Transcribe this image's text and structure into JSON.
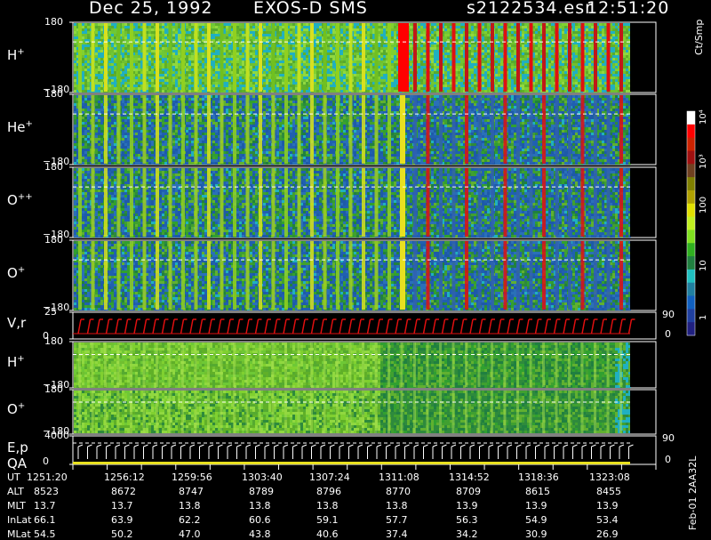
{
  "header": {
    "date": "Dec 25, 1992",
    "instrument": "EXOS-D SMS",
    "file": "s2122534.esr",
    "time": "12:51:20"
  },
  "panels": [
    {
      "label": "H",
      "sup": "+",
      "ymax": "180",
      "ymin": "−180"
    },
    {
      "label": "He",
      "sup": "+",
      "ymax": "180",
      "ymin": "−180"
    },
    {
      "label": "O",
      "sup": "++",
      "ymax": "180",
      "ymin": "−180"
    },
    {
      "label": "O",
      "sup": "+",
      "ymax": "180",
      "ymin": "−180"
    },
    {
      "label": "V,r",
      "sup": "",
      "ymax": "25",
      "ymin": "0",
      "right": "90",
      "right2": "0"
    },
    {
      "label": "H",
      "sup": "+",
      "ymax": "180",
      "ymin": "−180"
    },
    {
      "label": "O",
      "sup": "+",
      "ymax": "180",
      "ymin": "−180"
    },
    {
      "label": "E,p",
      "label2": "QA",
      "sup": "",
      "ymax": "4000",
      "ymin": "0",
      "right": "90",
      "right2": "0"
    }
  ],
  "colorbar": {
    "unit": "Ct/Smp",
    "labels": [
      "10⁴",
      "10³",
      "100",
      "10",
      "1"
    ],
    "colors": [
      "#ffffff",
      "#ff0000",
      "#cc2200",
      "#a01010",
      "#704020",
      "#808000",
      "#b0a000",
      "#e0e000",
      "#c0f020",
      "#80e020",
      "#30b020",
      "#208040",
      "#20c0c0",
      "#2080a0",
      "#1060c0",
      "#2040a0",
      "#202080"
    ]
  },
  "chart_data": {
    "type": "heatmap",
    "title": "Dec 25, 1992   EXOS-D SMS",
    "x_axis": {
      "label": "UT",
      "ticks": [
        "1251:20",
        "1256:12",
        "1259:56",
        "1303:40",
        "1307:24",
        "1311:08",
        "1314:52",
        "1318:36",
        "1323:08"
      ]
    },
    "ephemeris": [
      {
        "name": "ALT",
        "values": [
          "8523",
          "8672",
          "8747",
          "8789",
          "8796",
          "8770",
          "8709",
          "8615",
          "8455"
        ]
      },
      {
        "name": "MLT",
        "values": [
          "13.7",
          "13.7",
          "13.8",
          "13.8",
          "13.8",
          "13.8",
          "13.9",
          "13.9",
          "13.9"
        ]
      },
      {
        "name": "InLat",
        "values": [
          "66.1",
          "63.9",
          "62.2",
          "60.6",
          "59.1",
          "57.7",
          "56.3",
          "54.9",
          "53.4"
        ]
      },
      {
        "name": "MLat",
        "values": [
          "54.5",
          "50.2",
          "47.0",
          "43.8",
          "40.6",
          "37.4",
          "34.2",
          "30.9",
          "26.9"
        ]
      }
    ],
    "colorbar_unit": "Ct/Smp",
    "side_label": "Feb-01 2AA32L"
  }
}
